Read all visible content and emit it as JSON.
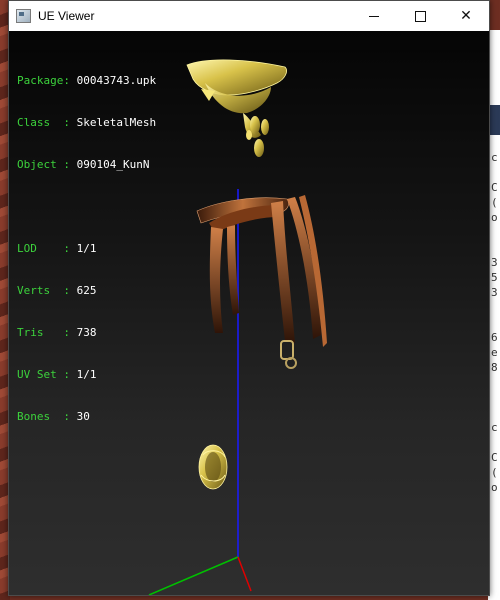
{
  "window": {
    "title": "UE Viewer",
    "min_label": "",
    "max_label": "",
    "close_label": "✕"
  },
  "info": {
    "package": {
      "label": "Package:",
      "value": "00043743.upk"
    },
    "class": {
      "label": "Class  :",
      "value": "SkeletalMesh"
    },
    "object": {
      "label": "Object :",
      "value": "090104_KunN"
    },
    "lod": {
      "label": "LOD    :",
      "value": "1/1"
    },
    "verts": {
      "label": "Verts  :",
      "value": "625"
    },
    "tris": {
      "label": "Tris   :",
      "value": "738"
    },
    "uvset": {
      "label": "UV Set :",
      "value": "1/1"
    },
    "bones": {
      "label": "Bones  :",
      "value": "30"
    }
  },
  "colors": {
    "label_green": "#3cd23c",
    "axis_blue": "#1a1aff",
    "axis_red": "#e00000",
    "axis_green": "#00c000",
    "gold": "#d8c24a",
    "leather": "#8a4a22"
  },
  "background_text": [
    "c",
    "",
    "C",
    "(",
    "o",
    "",
    "",
    "3",
    "5",
    "3",
    "",
    "",
    "6",
    "e",
    "8",
    "",
    "",
    "",
    "c",
    "",
    "C",
    "(",
    "o"
  ]
}
